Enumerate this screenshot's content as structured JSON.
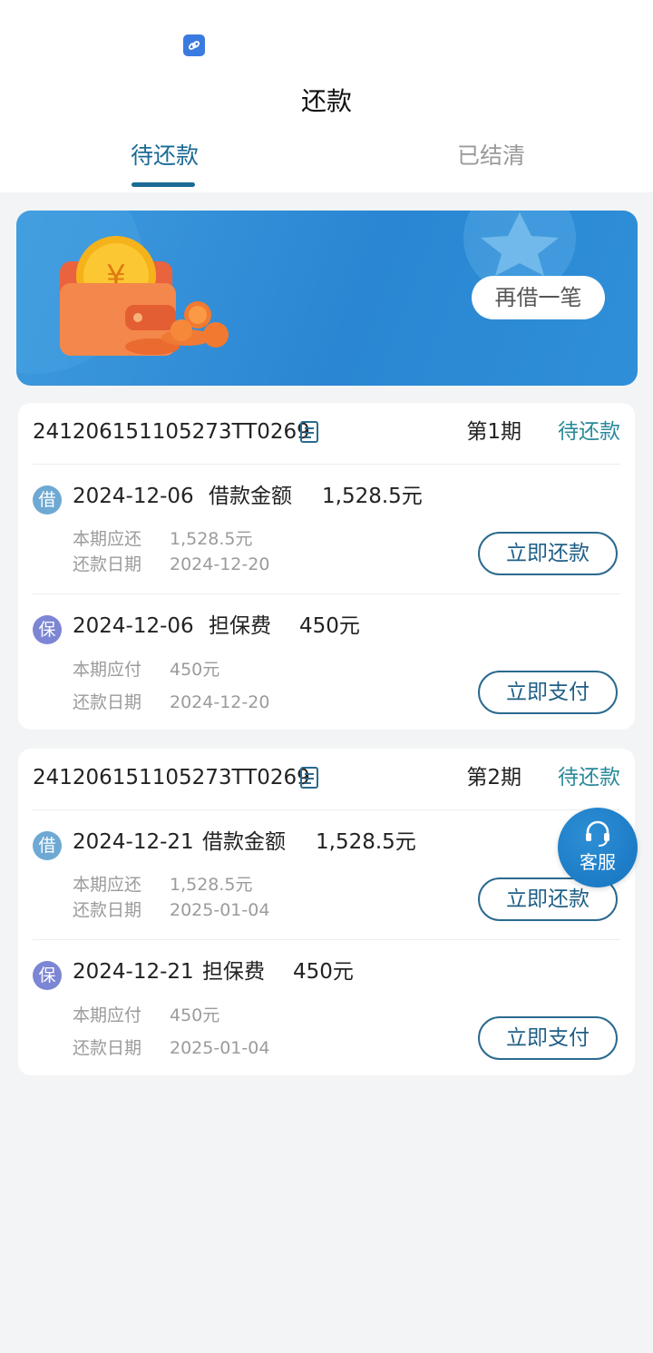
{
  "header": {
    "title": "还款",
    "tabs": [
      {
        "label": "待还款",
        "active": true
      },
      {
        "label": "已结清",
        "active": false
      }
    ]
  },
  "banner": {
    "button_label": "再借一笔"
  },
  "orders": [
    {
      "order_no": "241206151105273TT0269",
      "period": "第1期",
      "status": "待还款",
      "rows": [
        {
          "badge": "借",
          "date": "2024-12-06",
          "type": "借款金额",
          "amount": "1,528.5元",
          "due_label": "本期应还",
          "due_value": "1,528.5元",
          "date_label": "还款日期",
          "date_value": "2024-12-20",
          "action": "立即还款"
        },
        {
          "badge": "保",
          "date": "2024-12-06",
          "type": "担保费",
          "amount": "450元",
          "due_label": "本期应付",
          "due_value": "450元",
          "date_label": "还款日期",
          "date_value": "2024-12-20",
          "action": "立即支付"
        }
      ]
    },
    {
      "order_no": "241206151105273TT0269",
      "period": "第2期",
      "status": "待还款",
      "rows": [
        {
          "badge": "借",
          "date": "2024-12-21",
          "type": "借款金额",
          "amount": "1,528.5元",
          "due_label": "本期应还",
          "due_value": "1,528.5元",
          "date_label": "还款日期",
          "date_value": "2025-01-04",
          "action": "立即还款"
        },
        {
          "badge": "保",
          "date": "2024-12-21",
          "type": "担保费",
          "amount": "450元",
          "due_label": "本期应付",
          "due_value": "450元",
          "date_label": "还款日期",
          "date_value": "2025-01-04",
          "action": "立即支付"
        }
      ]
    }
  ],
  "customer_service": {
    "label": "客服",
    "icon": "headset-icon"
  },
  "colors": {
    "accent": "#1a6b95",
    "status": "#2a8a9a",
    "banner": "#2a86d2",
    "badge_loan": "#6ea9d3",
    "badge_guarantee": "#7d86d4"
  }
}
